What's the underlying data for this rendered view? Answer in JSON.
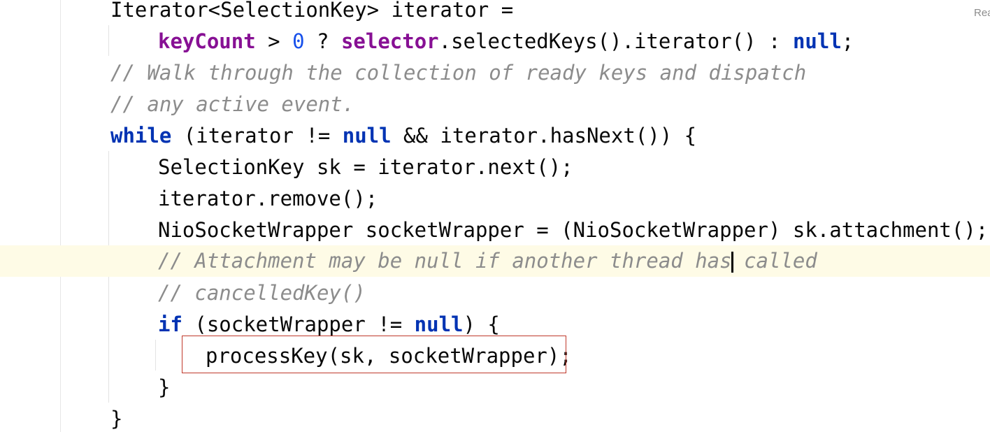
{
  "editor": {
    "hint_text": "Rea",
    "lines": {
      "l1": {
        "text": "Iterator<SelectionKey> iterator ="
      },
      "l2": {
        "a": "keyCount",
        "b": " > ",
        "c": "0",
        "d": " ? ",
        "e": "selector",
        "f": ".selectedKeys().iterator() : ",
        "g": "null",
        "h": ";"
      },
      "l3": {
        "text": "// Walk through the collection of ready keys and dispatch"
      },
      "l4": {
        "text": "// any active event."
      },
      "l5": {
        "a": "while",
        "b": " (iterator != ",
        "c": "null",
        "d": " && iterator.hasNext()) {"
      },
      "l6": {
        "text": "SelectionKey sk = iterator.next();"
      },
      "l7": {
        "text": "iterator.remove();"
      },
      "l8": {
        "text": "NioSocketWrapper socketWrapper = (NioSocketWrapper) sk.attachment();"
      },
      "l9": {
        "before_caret": "// Attachment may be null if another thread has",
        "after_caret": " called"
      },
      "l10": {
        "text": "// cancelledKey()"
      },
      "l11": {
        "a": "if",
        "b": " (socketWrapper != ",
        "c": "null",
        "d": ") {"
      },
      "l12": {
        "text": "processKey(sk, socketWrapper);"
      },
      "l13": {
        "text": "}"
      },
      "l14": {
        "text": "}"
      }
    },
    "highlight_color": "#c0392b",
    "current_line_color": "#fefbe6",
    "keyword_color": "#0033b3",
    "field_color": "#871094",
    "comment_color": "#8c8c8c"
  }
}
